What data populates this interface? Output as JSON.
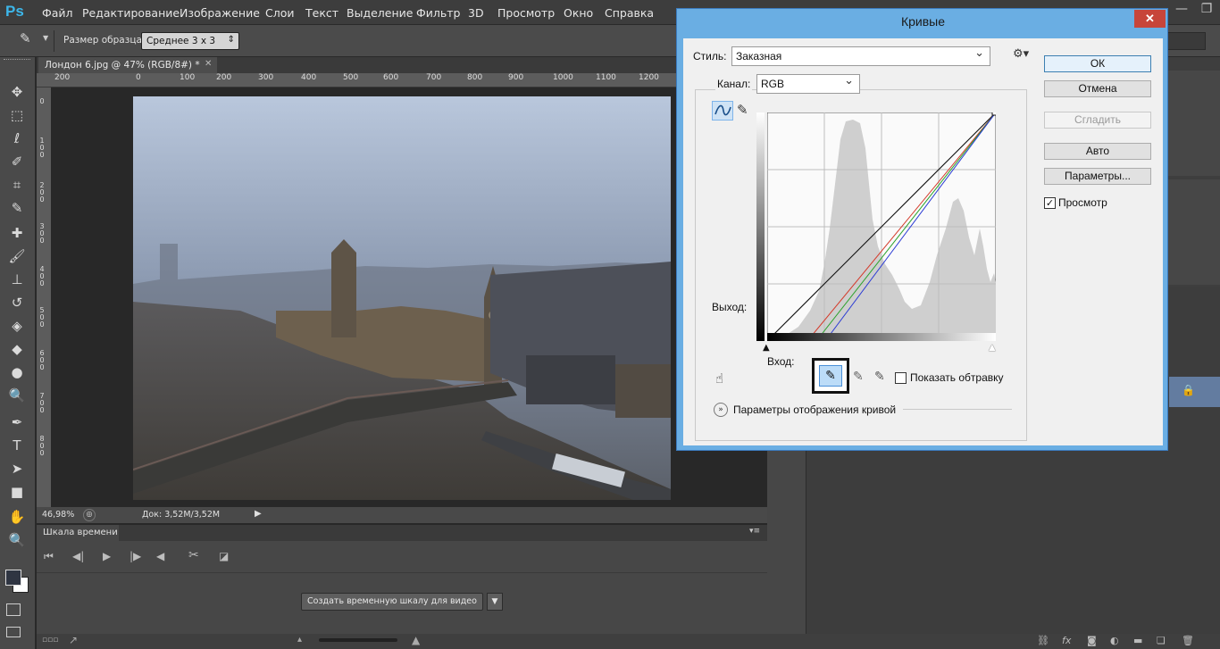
{
  "app": {
    "logo": "Ps"
  },
  "menu": [
    "Файл",
    "Редактирование",
    "Изображение",
    "Слои",
    "Текст",
    "Выделение",
    "Фильтр",
    "3D",
    "Просмотр",
    "Окно",
    "Справка"
  ],
  "options_bar": {
    "sample_label": "Размер образца:",
    "sample_value": "Среднее 3 x 3"
  },
  "document": {
    "tab_title": "Лондон 6.jpg @ 47% (RGB/8#) *",
    "ruler_top": [
      "200",
      "0",
      "100",
      "200",
      "300",
      "400",
      "500",
      "600",
      "700",
      "800",
      "900",
      "1000",
      "1100",
      "1200"
    ],
    "ruler_left": [
      "0",
      "1 0 0",
      "2 0 0",
      "3 0 0",
      "4 0 0",
      "5 0 0",
      "6 0 0",
      "7 0 0",
      "8 0 0"
    ],
    "zoom": "46,98%",
    "doc_size": "Док: 3,52M/3,52M"
  },
  "timeline": {
    "tab": "Шкала времени",
    "create_button": "Создать временную шкалу для видео"
  },
  "curves_dialog": {
    "title": "Кривые",
    "close": "✕",
    "style_label": "Стиль:",
    "style_value": "Заказная",
    "channel_label": "Канал:",
    "channel_value": "RGB",
    "output_label": "Выход:",
    "input_label": "Вход:",
    "show_clipping": "Показать обтравку",
    "curve_display_options": "Параметры отображения кривой",
    "buttons": {
      "ok": "ОК",
      "cancel": "Отмена",
      "smooth": "Сгладить",
      "auto": "Авто",
      "options": "Параметры..."
    },
    "preview_label": "Просмотр",
    "preview_checked": true,
    "colors": {
      "red": "#d43a2a",
      "green": "#2aa22a",
      "blue": "#2a3ad4",
      "composite": "#111111"
    }
  }
}
